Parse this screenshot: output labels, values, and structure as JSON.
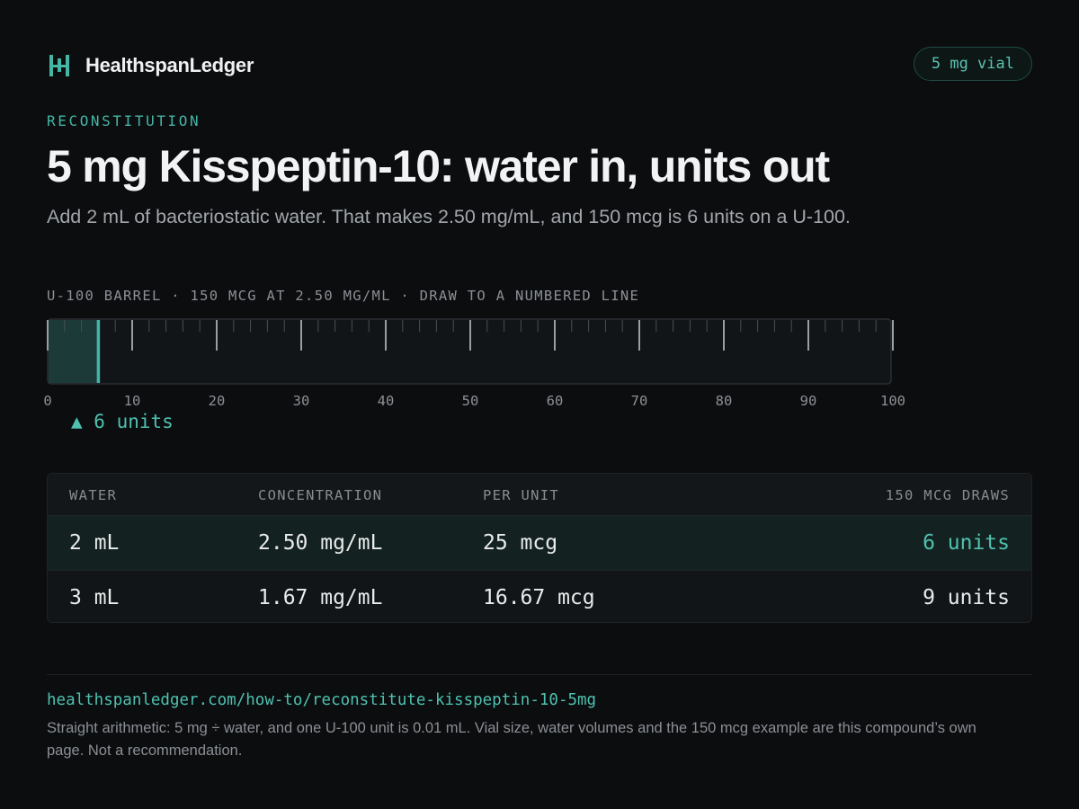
{
  "brand": {
    "name": "HealthspanLedger",
    "logo_icon": "ledger-h-icon"
  },
  "vial_badge": "5 mg vial",
  "eyebrow": "RECONSTITUTION",
  "headline": "5 mg Kisspeptin-10: water in, units out",
  "subheadline": "Add 2 mL of bacteriostatic water. That makes 2.50 mg/mL, and 150 mcg is 6 units on a U-100.",
  "scale": {
    "caption": "U-100 BARREL · 150 MCG AT 2.50 MG/ML · DRAW TO A NUMBERED LINE",
    "min": 0,
    "max": 100,
    "major_step": 10,
    "minor_step": 2,
    "labels": [
      "0",
      "10",
      "20",
      "30",
      "40",
      "50",
      "60",
      "70",
      "80",
      "90",
      "100"
    ],
    "fill_units": 6,
    "marker_label": "▲ 6 units",
    "accent_color": "#45b5a5"
  },
  "table": {
    "headers": [
      "WATER",
      "CONCENTRATION",
      "PER UNIT",
      "150 MCG DRAWS"
    ],
    "rows": [
      {
        "water": "2 mL",
        "concentration": "2.50 mg/mL",
        "per_unit": "25 mcg",
        "draws": "6 units",
        "highlighted": true
      },
      {
        "water": "3 mL",
        "concentration": "1.67 mg/mL",
        "per_unit": "16.67 mcg",
        "draws": "9 units",
        "highlighted": false
      }
    ]
  },
  "footer": {
    "url": "healthspanledger.com/how-to/reconstitute-kisspeptin-10-5mg",
    "note": "Straight arithmetic: 5 mg ÷ water, and one U-100 unit is 0.01 mL. Vial size, water volumes and the 150 mcg example are this compound’s own page. Not a recommendation."
  }
}
